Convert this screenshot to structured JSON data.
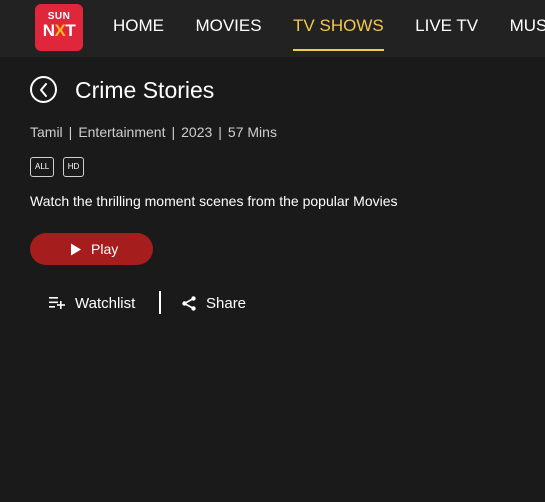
{
  "logo": {
    "top_text": "SUN",
    "bottom_text_before": "N",
    "bottom_text_x": "X",
    "bottom_text_after": "T",
    "color": "#e0263a"
  },
  "nav": {
    "items": [
      {
        "label": "HOME",
        "active": false
      },
      {
        "label": "MOVIES",
        "active": false
      },
      {
        "label": "TV SHOWS",
        "active": true
      },
      {
        "label": "LIVE TV",
        "active": false
      },
      {
        "label": "MUSIC VIDEOS",
        "active": false
      }
    ],
    "active_color": "#f2c94c"
  },
  "content": {
    "back_icon": "chevron-left-icon",
    "title": "Crime Stories",
    "meta": {
      "language": "Tamil",
      "genre": "Entertainment",
      "year": "2023",
      "duration": "57 Mins",
      "separator": "|"
    },
    "badges": [
      "ALL",
      "HD"
    ],
    "description": "Watch the thrilling moment scenes from the popular Movies",
    "play": {
      "label": "Play",
      "icon": "play-icon",
      "color": "#a51d1d"
    },
    "watchlist": {
      "label": "Watchlist",
      "icon": "playlist-add-icon"
    },
    "share": {
      "label": "Share",
      "icon": "share-icon"
    }
  }
}
